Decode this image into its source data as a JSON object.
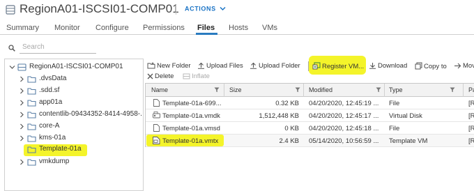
{
  "header": {
    "title": "RegionA01-ISCSI01-COMP01",
    "actions_label": "ACTIONS"
  },
  "tabs": [
    {
      "label": "Summary"
    },
    {
      "label": "Monitor"
    },
    {
      "label": "Configure"
    },
    {
      "label": "Permissions"
    },
    {
      "label": "Files",
      "active": true
    },
    {
      "label": "Hosts"
    },
    {
      "label": "VMs"
    }
  ],
  "search": {
    "placeholder": "Search"
  },
  "tree": {
    "root": "RegionA01-ISCSI01-COMP01",
    "items": [
      {
        "label": ".dvsData"
      },
      {
        "label": ".sdd.sf"
      },
      {
        "label": "app01a"
      },
      {
        "label": "contentlib-09434352-8414-4958-..."
      },
      {
        "label": "core-A"
      },
      {
        "label": "kms-01a"
      },
      {
        "label": "Template-01a",
        "selected": true
      },
      {
        "label": "vmkdump"
      }
    ]
  },
  "toolbar": {
    "new_folder": "New Folder",
    "upload_files": "Upload Files",
    "upload_folder": "Upload Folder",
    "register_vm": "Register VM...",
    "download": "Download",
    "copy_to": "Copy to",
    "move_to": "Mov",
    "delete": "Delete",
    "inflate": "Inflate"
  },
  "table": {
    "columns": [
      "Name",
      "Size",
      "Modified",
      "Type",
      "Pa"
    ],
    "rows": [
      {
        "name": "Template-01a-699...",
        "size": "0.32 KB",
        "modified": "04/20/2020, 12:45:19 ...",
        "type": "File",
        "path": "[R"
      },
      {
        "name": "Template-01a.vmdk",
        "size": "1,512,448 KB",
        "modified": "04/20/2020, 12:45:17 ...",
        "type": "Virtual Disk",
        "path": "[R"
      },
      {
        "name": "Template-01a.vmsd",
        "size": "0 KB",
        "modified": "04/20/2020, 12:45:18 ...",
        "type": "File",
        "path": "[R"
      },
      {
        "name": "Template-01a.vmtx",
        "size": "2.4 KB",
        "modified": "05/14/2020, 10:56:59 ...",
        "type": "Template VM",
        "path": "[R"
      }
    ]
  },
  "colors": {
    "highlight": "#f4f42a",
    "accent": "#1a73c5",
    "tab_underline": "#2a7bc0",
    "folder": "#5a7fa6"
  }
}
